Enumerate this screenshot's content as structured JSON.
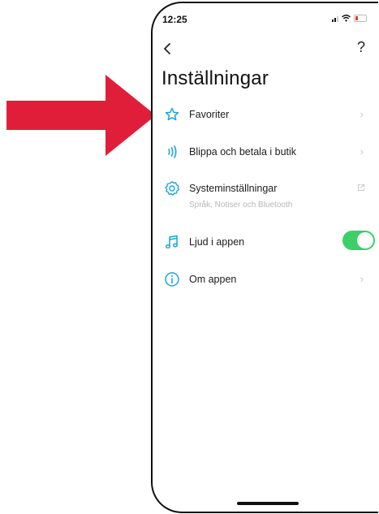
{
  "status_bar": {
    "time": "12:25"
  },
  "nav": {
    "help_label": "?"
  },
  "page": {
    "title": "Inställningar"
  },
  "settings": [
    {
      "label": "Favoriter",
      "icon": "star-icon",
      "trailing": "chevron"
    },
    {
      "label": "Blippa och betala i butik",
      "icon": "contactless-icon",
      "trailing": "chevron"
    },
    {
      "label": "Systeminställningar",
      "sublabel": "Språk, Notiser och Bluetooth",
      "icon": "gear-icon",
      "trailing": "external-link"
    },
    {
      "label": "Ljud i appen",
      "icon": "music-note-icon",
      "trailing": "toggle",
      "toggle_on": true
    },
    {
      "label": "Om appen",
      "icon": "info-icon",
      "trailing": "chevron"
    }
  ],
  "colors": {
    "accent": "#1aa5d8",
    "toggle_on": "#3ccf68",
    "arrow": "#e01e3a"
  }
}
